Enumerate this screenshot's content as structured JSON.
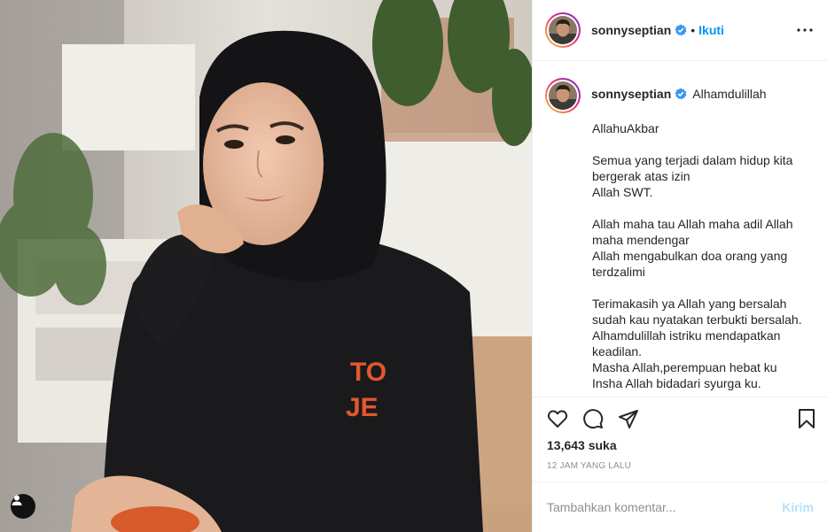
{
  "post": {
    "author": "sonnyseptian",
    "verified": true,
    "follow_label": "Ikuti",
    "separator": "•",
    "more_icon": "more-horizontal-icon"
  },
  "caption": {
    "author": "sonnyseptian",
    "first_line": "Alhamdulillah",
    "lines": [
      "AllahuAkbar",
      "Semua yang terjadi dalam hidup kita bergerak atas izin",
      "Allah SWT.",
      "Allah maha tau Allah maha adil Allah maha mendengar",
      "Allah mengabulkan doa orang yang terdzalimi",
      "Terimakasih ya Allah yang bersalah sudah kau nyatakan terbukti bersalah.",
      "Alhamdulillah istriku mendapatkan keadilan.",
      "Masha Allah,perempuan hebat ku",
      "Insha Allah bidadari syurga ku."
    ]
  },
  "actions": {
    "icons": [
      "heart-icon",
      "comment-icon",
      "share-icon",
      "bookmark-icon"
    ],
    "likes": "13,643 suka",
    "timestamp": "12 JAM YANG LALU"
  },
  "comment": {
    "placeholder": "Tambahkan komentar...",
    "post_label": "Kirim"
  },
  "colors": {
    "accent_blue": "#0095f6",
    "post_disabled": "#b2dffc",
    "verified_blue": "#3897f0",
    "border": "#efefef"
  }
}
